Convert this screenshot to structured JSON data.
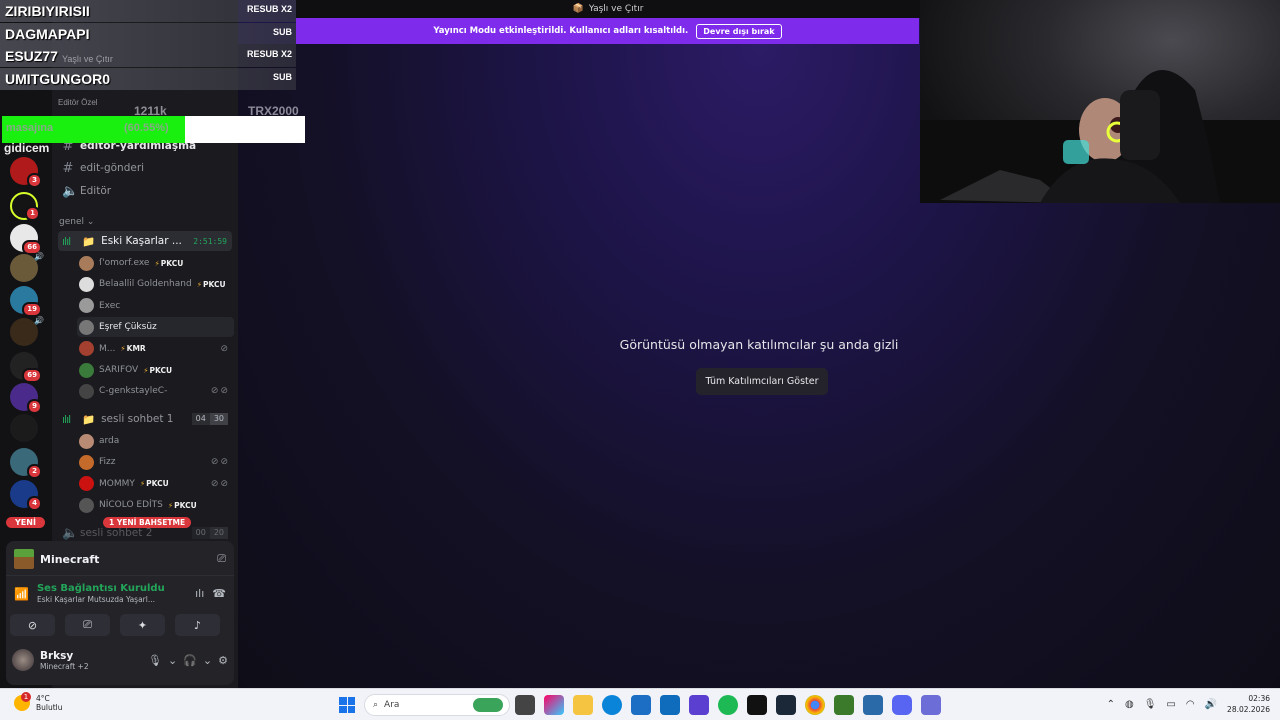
{
  "window_title": "Yaşlı ve Çıtır",
  "streamer_mode": {
    "text": "Yayıncı Modu etkinleştirildi. Kullanıcı adları kısaltıldı.",
    "button": "Devre dışı bırak"
  },
  "stage": {
    "message": "Görüntüsü olmayan katılımcılar şu anda gizli",
    "button": "Tüm Katılımcıları Göster"
  },
  "overlay": {
    "events": [
      {
        "name": "ZIRIBIYIRISII",
        "tag": "RESUB X2"
      },
      {
        "name": "DAGMAPAPI",
        "tag": "SUB"
      },
      {
        "name": "ESUZ77",
        "tag": "RESUB X2"
      },
      {
        "name": "UMITGUNGOR0",
        "tag": "SUB"
      }
    ],
    "faint_server": "Yaşlı ve Çıtır",
    "faint_cat": "Editör Özel",
    "faint_count": "1211k",
    "faint_user": "TRX2000",
    "faint_left": "gidicem",
    "goal_label": "masajına",
    "goal_percent_text": "(60.55%)",
    "goal_fraction": 0.6055
  },
  "sidebar": {
    "channels_top": [
      {
        "name": "editör-yardımlaşma",
        "icon": "hash"
      },
      {
        "name": "edit-gönderi",
        "icon": "hash"
      },
      {
        "name": "Editör",
        "icon": "speaker"
      }
    ],
    "category": "genel",
    "voice1": {
      "name": "Eski Kaşarlar ...",
      "timer": "2:51:59",
      "users": [
        {
          "name": "ſ'omorf.exe",
          "tag": "PKCU",
          "color": "#a87b5b"
        },
        {
          "name": "Belaallil Goldenhand",
          "tag": "PKCU",
          "color": "#ddd"
        },
        {
          "name": "Exec",
          "tag": "",
          "color": "#9a9a9a"
        },
        {
          "name": "Eşref Çüksüz",
          "tag": "",
          "color": "#777"
        },
        {
          "name": "M...",
          "tag": "KMR",
          "color": "#a4402f"
        },
        {
          "name": "SARIFOV",
          "tag": "PKCU",
          "color": "#3a7a3a"
        },
        {
          "name": "C-genkstayleC-",
          "tag": "",
          "color": "#444"
        }
      ]
    },
    "voice2": {
      "name": "sesli sohbet 1",
      "count": "04",
      "limit": "30",
      "users": [
        {
          "name": "arda",
          "tag": "",
          "color": "#b98b74"
        },
        {
          "name": "Fizz",
          "tag": "",
          "color": "#c46a2a"
        },
        {
          "name": "MOMMY",
          "tag": "PKCU",
          "color": "#c11"
        },
        {
          "name": "NİCOLO EDİTS",
          "tag": "PKCU",
          "color": "#555"
        }
      ]
    },
    "voice3": {
      "name": "sesli sohbet 2",
      "count": "00",
      "limit": "20"
    },
    "mention_pill": "1 YENİ BAHSETME",
    "new_pill": "YENİ"
  },
  "userpanel": {
    "game": "Minecraft",
    "rtc_status": "Ses Bağlantısı Kuruldu",
    "rtc_channel": "Eski Kaşarlar Mutsuzda Yaşarl...",
    "username": "Brksy",
    "user_activity": "Minecraft +2"
  },
  "taskbar": {
    "weather_temp": "4°C",
    "weather_desc": "Bulutlu",
    "weather_badge": "1",
    "search_placeholder": "Ara",
    "time": "02:36",
    "date": "28.02.2026"
  },
  "colors": {
    "accent": "#7f2bec",
    "voice_green": "#23a55a",
    "mention_red": "#da373c",
    "goal_green": "#19f00f"
  }
}
